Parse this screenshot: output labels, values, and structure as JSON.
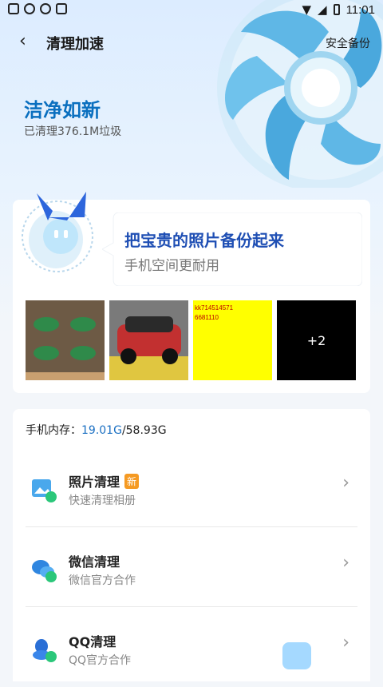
{
  "statusbar": {
    "time": "11:01"
  },
  "topbar": {
    "title": "清理加速",
    "backup": "安全备份"
  },
  "hero": {
    "headline": "洁净如新",
    "cleaned": "已清理376.1M垃圾"
  },
  "promo": {
    "title": "把宝贵的照片备份起来",
    "subtitle": "手机空间更耐用",
    "thumb3_line1": "kk714514571",
    "thumb3_line2": "6681110",
    "more": "+2"
  },
  "storage": {
    "label": "手机内存：",
    "used": "19.01G",
    "total": "/58.93G"
  },
  "items": [
    {
      "name": "照片清理",
      "badge": "新",
      "desc": "快速清理相册",
      "icon": "photo-clean-icon"
    },
    {
      "name": "微信清理",
      "desc": "微信官方合作",
      "icon": "wechat-clean-icon"
    },
    {
      "name": "QQ清理",
      "desc": "QQ官方合作",
      "icon": "qq-clean-icon"
    }
  ],
  "colors": {
    "accent": "#1a6fc2",
    "headline": "#0a6fbf",
    "badge": "#f59a23"
  }
}
